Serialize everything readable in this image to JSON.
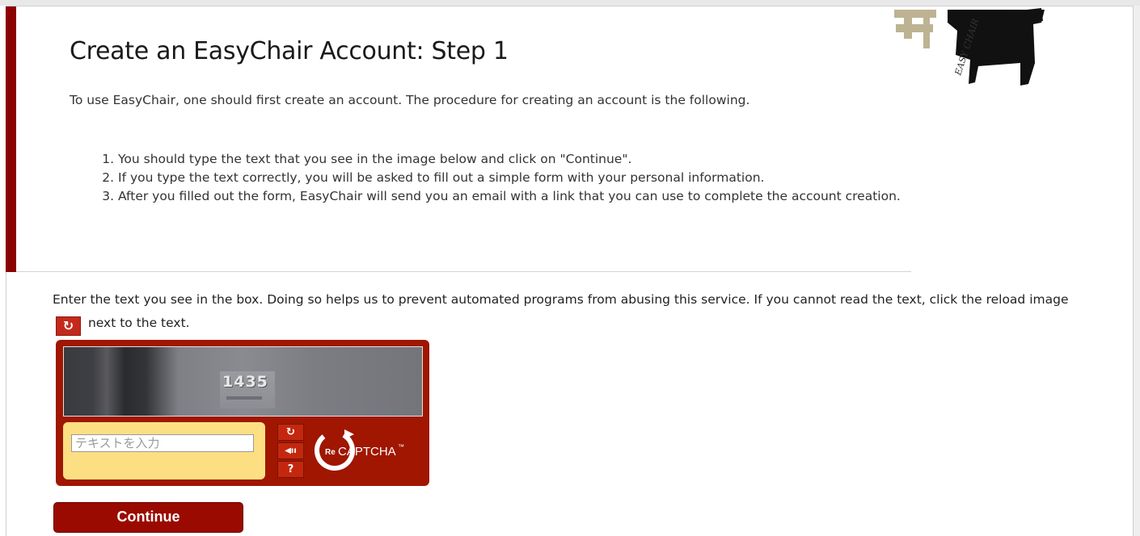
{
  "page": {
    "title": "Create an EasyChair Account: Step 1",
    "intro": "To use EasyChair, one should first create an account. The procedure for creating an account is the following.",
    "steps": [
      "You should type the text that you see in the image below and click on \"Continue\".",
      "If you type the text correctly, you will be asked to fill out a simple form with your personal information.",
      "After you filled out the form, EasyChair will send you an email with a link that you can use to complete the account creation."
    ]
  },
  "logo": {
    "text": "EASY CHAIR"
  },
  "captcha": {
    "instructions_before": "Enter the text you see in the box. Doing so helps us to prevent automated programs from abusing this service. If you cannot read the text, click the reload image",
    "instructions_after": "next to the text.",
    "image_text": "1435",
    "input_placeholder": "テキストを入力",
    "input_value": "",
    "brand_prefix": "Re",
    "brand_name": "CAPTCHA",
    "brand_tm": "™",
    "controls": [
      {
        "icon": "reload-icon",
        "glyph": "↻"
      },
      {
        "icon": "audio-icon",
        "glyph": "◀ıı"
      },
      {
        "icon": "help-icon",
        "glyph": "?"
      }
    ]
  },
  "actions": {
    "continue_label": "Continue"
  },
  "colors": {
    "accent": "#8b0000",
    "captcha_frame": "#a01600",
    "captcha_input_bg": "#fcdf82",
    "button": "#9a0a00"
  }
}
